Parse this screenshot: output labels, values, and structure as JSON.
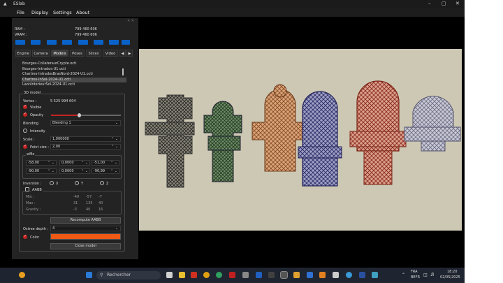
{
  "window": {
    "title": "ESlab",
    "minimize": "–",
    "maximize": "▢",
    "close": "✕"
  },
  "menu": [
    "File",
    "Display",
    "Settings",
    "About"
  ],
  "stats": {
    "ram_label": "RAM :",
    "ram_value": "799 460 606",
    "vram_label": "VRAM :",
    "vram_value": "799 460 606"
  },
  "tabs": [
    "Engine",
    "Camera",
    "Models",
    "Poses",
    "Slices",
    "Video"
  ],
  "active_tab": "Models",
  "files": [
    "Bourges-CollateraurCrypte.octi",
    "Bourges-Intrados-U1.octi",
    "Chartres-IntradosBrasNord-2024-U1.octi",
    "Chartres-InSol-2024-U1.octi",
    "LaonInterieurSol-2024-U1.octi"
  ],
  "selected_file_index": 3,
  "model": {
    "group_title": "3D model",
    "vertex_label": "Vertex :",
    "vertex_value": "5 525 994 604",
    "visible_label": "Visible",
    "opacity_label": "Opacity",
    "opacity_level": 0.4,
    "blending_label": "Blending",
    "blending_value": "Blending 1",
    "intensity_label": "Intensity",
    "scale_label": "Scale :",
    "scale_value": "1,000000",
    "pointsize_label": "Point size :",
    "pointsize_value": "2,00",
    "wmo_title": "wMo",
    "wmo_row1": [
      "-58,00",
      "0,0000",
      "-51,00"
    ],
    "wmo_row2": [
      "-90,00",
      "0,0000",
      "-90,99"
    ],
    "inversion_label": "Inversion :",
    "inv_x": "X",
    "inv_y": "Y",
    "inv_z": "Z",
    "aabb_title": "AABB",
    "aabb_min_label": "Min :",
    "aabb_min": [
      "-40",
      "-57",
      "-7"
    ],
    "aabb_max_label": "Max :",
    "aabb_max": [
      "31",
      "135",
      "40"
    ],
    "aabb_grav_label": "Gravity :",
    "aabb_grav": [
      "-3",
      "40",
      "16"
    ],
    "recompute_label": "Recompute AABB",
    "octree_label": "Octree depth :",
    "octree_value": "4",
    "color_label": "Color",
    "color_hex": "#f05a14",
    "close_label": "Close model"
  },
  "taskbar": {
    "search_placeholder": "Rechercher",
    "lang": "FRA",
    "layout": "BEFR",
    "time": "18:20",
    "date": "02/05/2025"
  },
  "colors": {
    "accent": "#0a62c8",
    "check": "#c4231f",
    "viewport_bg": "#cdc8b4"
  }
}
